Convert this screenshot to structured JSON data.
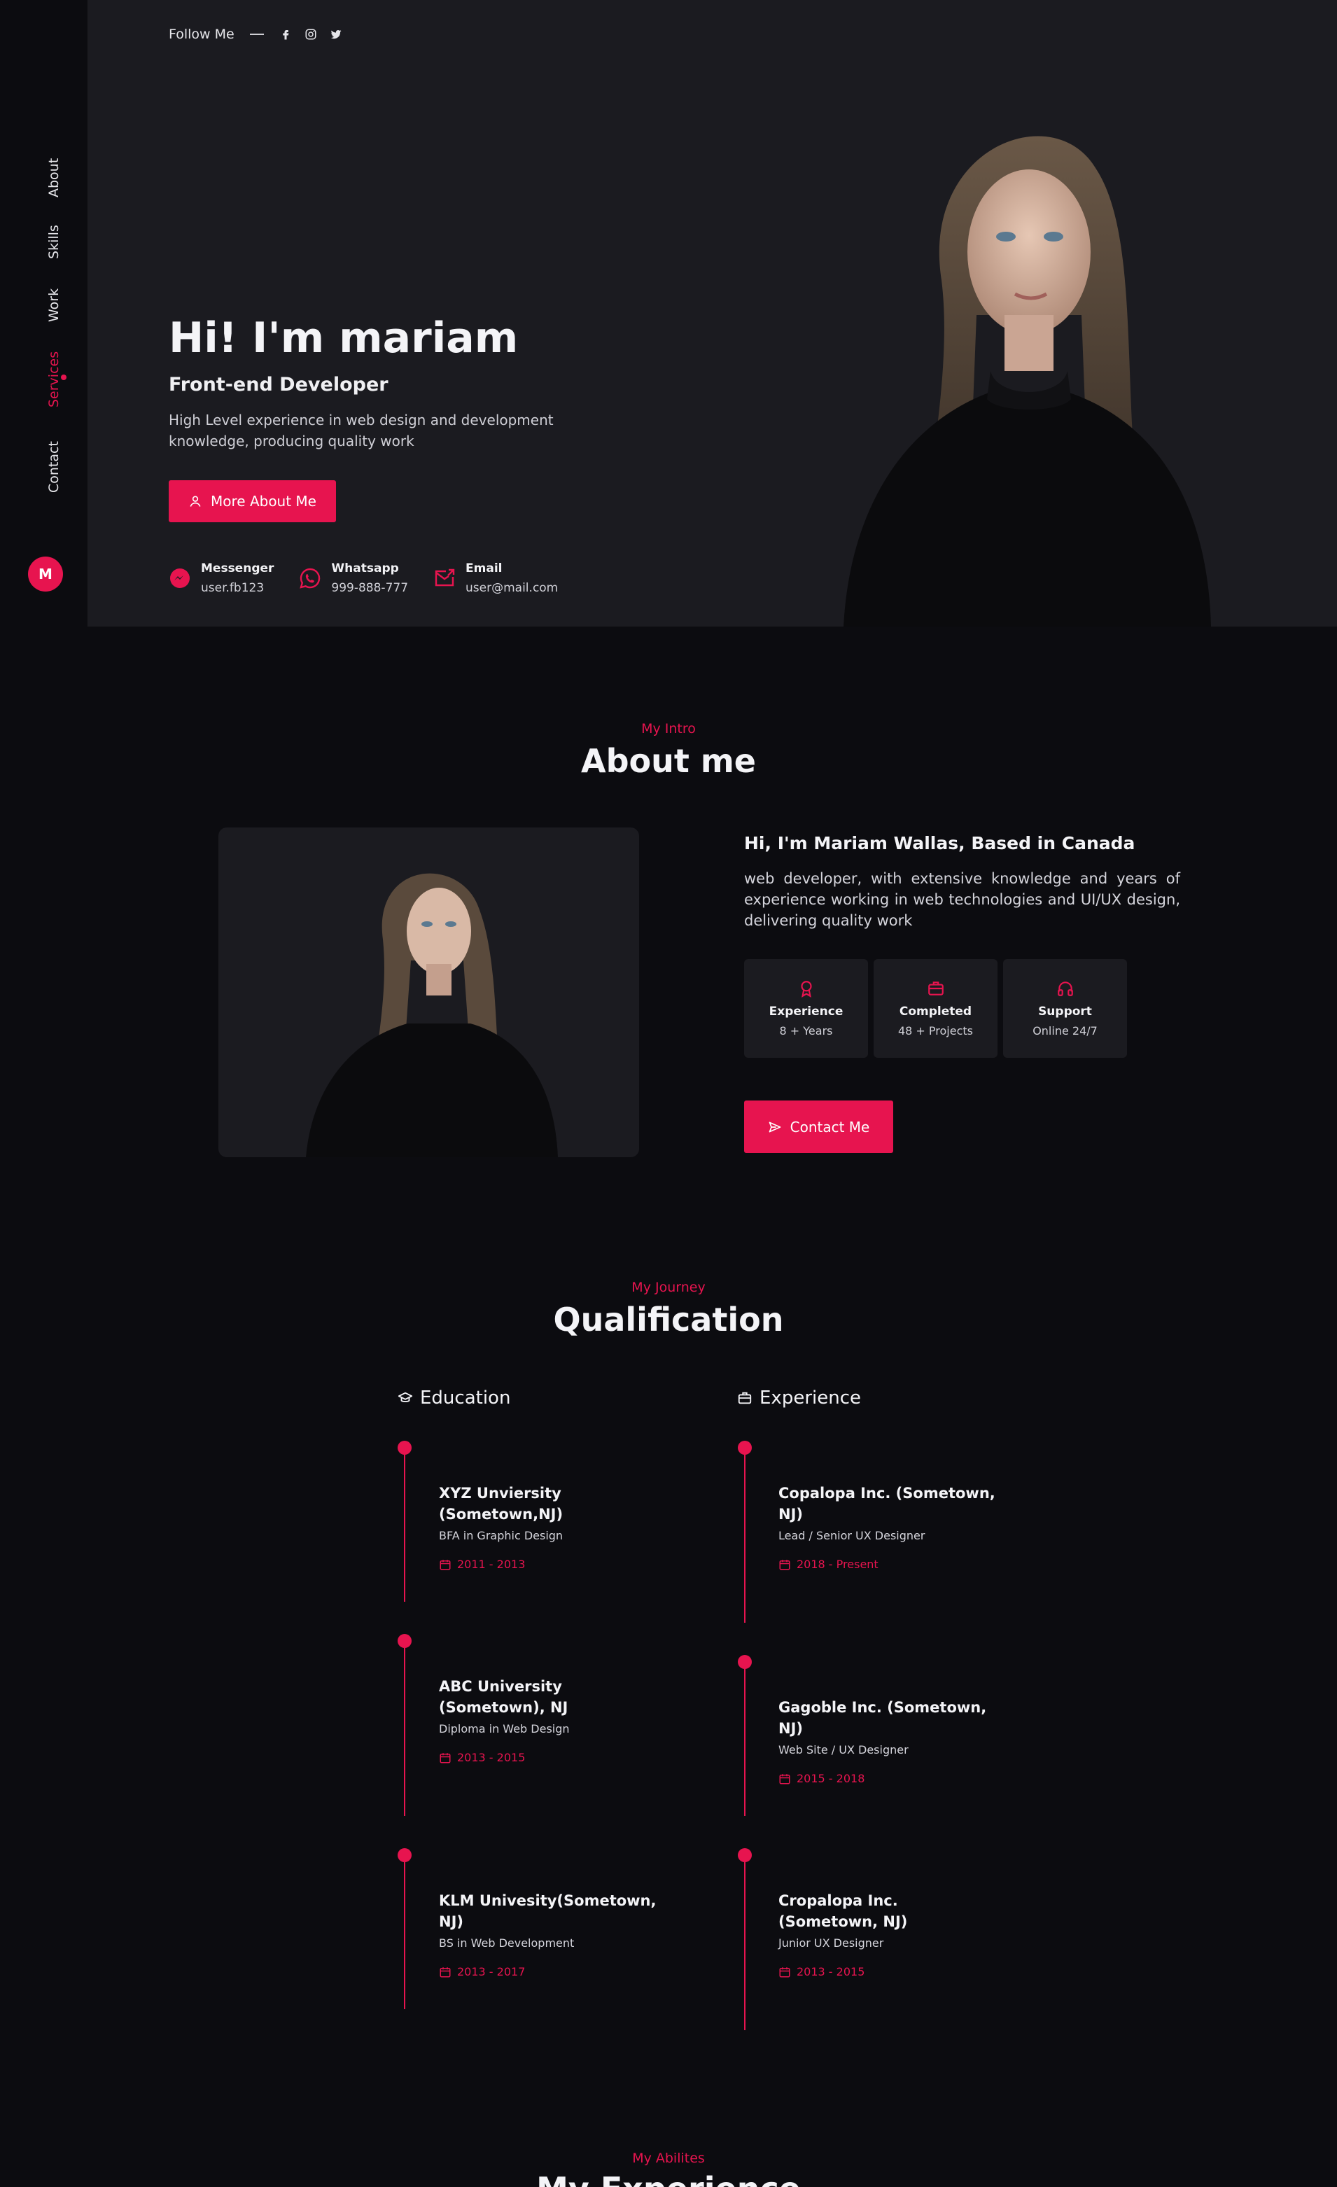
{
  "sidebar": {
    "items": [
      {
        "label": "About"
      },
      {
        "label": "Skills"
      },
      {
        "label": "Work"
      },
      {
        "label": "Services"
      },
      {
        "label": "Contact"
      }
    ],
    "logo": "M"
  },
  "hero": {
    "follow_label": "Follow Me",
    "title": "Hi! I'm mariam",
    "subtitle": "Front-end Developer",
    "description": "High Level experience in web design and development knowledge, producing quality work",
    "button_label": "More About Me",
    "contacts": [
      {
        "title": "Messenger",
        "value": "user.fb123"
      },
      {
        "title": "Whatsapp",
        "value": "999-888-777"
      },
      {
        "title": "Email",
        "value": "user@mail.com"
      }
    ]
  },
  "about": {
    "kicker": "My Intro",
    "title": "About me",
    "heading": "Hi, I'm Mariam Wallas, Based in Canada",
    "text": "web developer, with extensive knowledge and years of experience working in web technologies and UI/UX design, delivering quality work",
    "stats": [
      {
        "title": "Experience",
        "value": "8 + Years"
      },
      {
        "title": "Completed",
        "value": "48 + Projects"
      },
      {
        "title": "Support",
        "value": "Online 24/7"
      }
    ],
    "button_label": "Contact Me"
  },
  "qualification": {
    "kicker": "My Journey",
    "title": "Qualification",
    "education_label": "Education",
    "experience_label": "Experience",
    "education": [
      {
        "title": "XYZ Unviersity (Sometown,NJ)",
        "sub": "BFA in Graphic Design",
        "date": "2011 - 2013"
      },
      {
        "title": "ABC University (Sometown), NJ",
        "sub": "Diploma in Web Design",
        "date": "2013 - 2015"
      },
      {
        "title": "KLM Univesity(Sometown, NJ)",
        "sub": "BS in Web Development",
        "date": "2013 - 2017"
      }
    ],
    "experience": [
      {
        "title": "Copalopa Inc. (Sometown, NJ)",
        "sub": "Lead / Senior UX Designer",
        "date": "2018 - Present"
      },
      {
        "title": "Gagoble Inc. (Sometown, NJ)",
        "sub": "Web Site / UX Designer",
        "date": "2015 - 2018"
      },
      {
        "title": "Cropalopa Inc. (Sometown, NJ)",
        "sub": "Junior UX Designer",
        "date": "2013 - 2015"
      }
    ]
  },
  "abilities": {
    "kicker": "My Abilites",
    "title": "My Experience"
  }
}
